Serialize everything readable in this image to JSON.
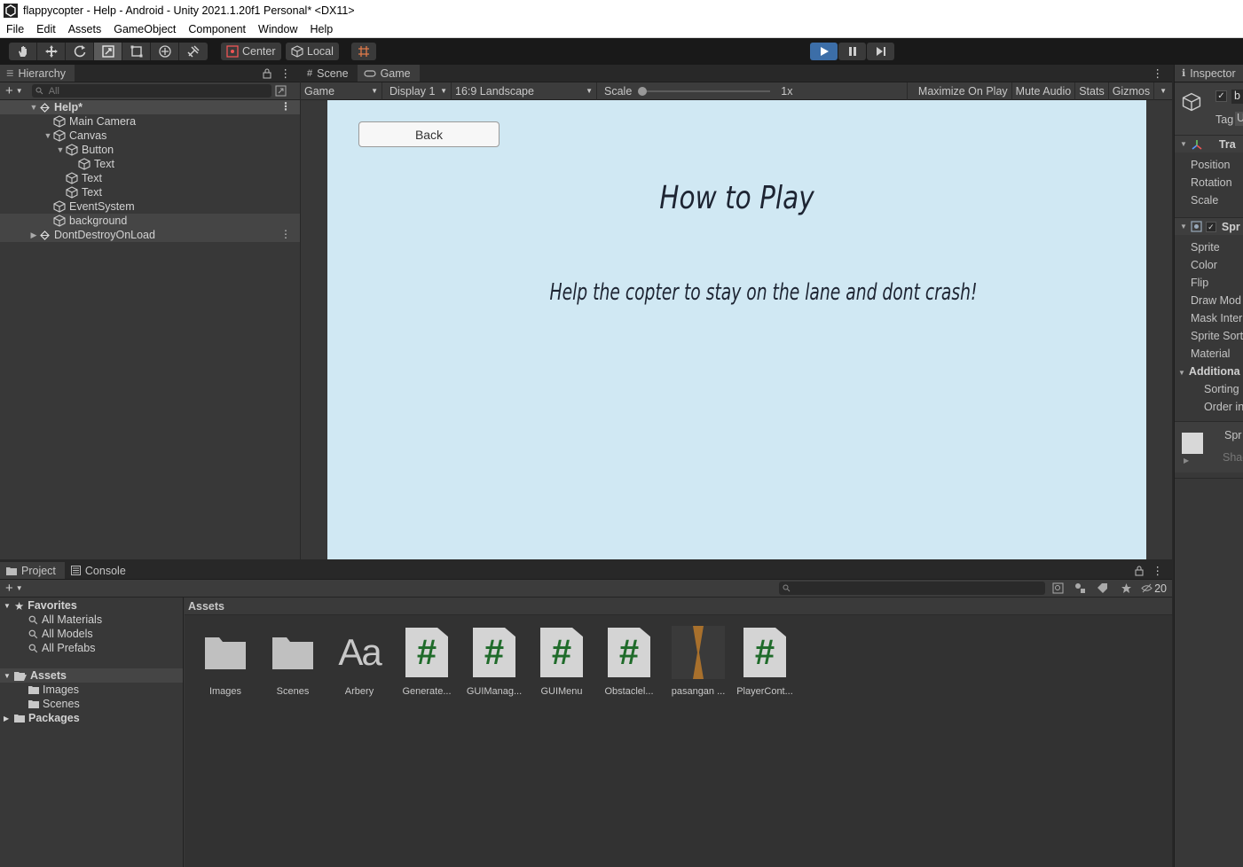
{
  "window": {
    "title": "flappycopter - Help - Android - Unity 2021.1.20f1 Personal* <DX11>"
  },
  "menu": [
    "File",
    "Edit",
    "Assets",
    "GameObject",
    "Component",
    "Window",
    "Help"
  ],
  "toolbar": {
    "pivot_label": "Center",
    "space_label": "Local",
    "accent": "#3c6ea8"
  },
  "hierarchy": {
    "tab": "Hierarchy",
    "search_placeholder": "All",
    "scene": "Help*",
    "items": [
      "Main Camera",
      "Canvas",
      "Button",
      "Text",
      "Text",
      "Text",
      "EventSystem",
      "background"
    ],
    "dont_destroy": "DontDestroyOnLoad"
  },
  "game": {
    "tabs": [
      "Scene",
      "Game"
    ],
    "bar": {
      "mode": "Game",
      "display": "Display 1",
      "aspect": "16:9 Landscape",
      "scale_label": "Scale",
      "scale_value": "1x",
      "maximize": "Maximize On Play",
      "mute": "Mute Audio",
      "stats": "Stats",
      "gizmos": "Gizmos"
    },
    "back_label": "Back",
    "heading": "How to Play",
    "help_text": "Help the copter to stay on the lane and dont crash!",
    "bg_color": "#d0e8f3"
  },
  "inspector": {
    "tab": "Inspector",
    "name_fragment": "b",
    "tag_label": "Tag",
    "tag_value": "U",
    "transform_head": "Tra",
    "transform_rows": [
      "Position",
      "Rotation",
      "Scale"
    ],
    "sprite_head": "Spr",
    "sprite_rows": [
      "Sprite",
      "Color",
      "Flip",
      "Draw Mod",
      "Mask Inter",
      "Sprite Sort",
      "Material"
    ],
    "additional_head": "Additiona",
    "additional_rows": [
      "Sorting",
      "Order in"
    ],
    "material_name": "Spr",
    "shader_label": "Shad"
  },
  "project": {
    "tabs": [
      "Project",
      "Console"
    ],
    "hidden_count": "20",
    "favorites": "Favorites",
    "favorite_items": [
      "All Materials",
      "All Models",
      "All Prefabs"
    ],
    "assets_root": "Assets",
    "asset_folders": [
      "Images",
      "Scenes"
    ],
    "packages": "Packages",
    "breadcrumb": "Assets",
    "assets": [
      {
        "label": "Images",
        "icon": "folder-icon"
      },
      {
        "label": "Scenes",
        "icon": "folder-icon"
      },
      {
        "label": "Arbery",
        "icon": "font-icon"
      },
      {
        "label": "Generate...",
        "icon": "script-icon"
      },
      {
        "label": "GUIManag...",
        "icon": "script-icon"
      },
      {
        "label": "GUIMenu",
        "icon": "script-icon"
      },
      {
        "label": "Obstaclel...",
        "icon": "script-icon"
      },
      {
        "label": "pasangan ...",
        "icon": "sprite-icon"
      },
      {
        "label": "PlayerCont...",
        "icon": "script-icon"
      }
    ],
    "font_glyph": "Aa"
  }
}
